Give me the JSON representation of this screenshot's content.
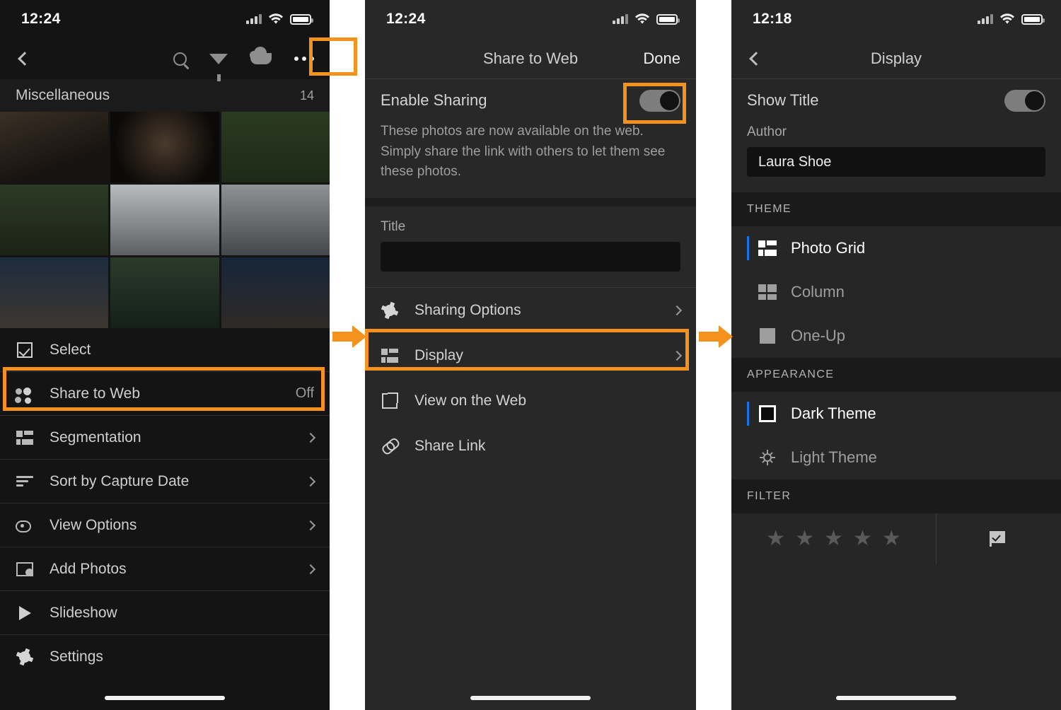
{
  "panels": [
    {
      "id": "album-menu",
      "status": {
        "time": "12:24"
      },
      "nav": {
        "back_icon": "chevron-left-icon",
        "tools": [
          "search-icon",
          "filter-icon",
          "cloud-icon",
          "more-options-icon"
        ]
      },
      "album": {
        "name": "Miscellaneous",
        "count": "14"
      },
      "menu": [
        {
          "label": "Select",
          "icon": "select-checkbox-icon",
          "value": "",
          "chevron": false
        },
        {
          "label": "Share to Web",
          "icon": "people-icon",
          "value": "Off",
          "chevron": false
        },
        {
          "label": "Segmentation",
          "icon": "segmentation-icon",
          "value": "",
          "chevron": true
        },
        {
          "label": "Sort by Capture Date",
          "icon": "sort-icon",
          "value": "",
          "chevron": true
        },
        {
          "label": "View Options",
          "icon": "eye-options-icon",
          "value": "",
          "chevron": true
        },
        {
          "label": "Add Photos",
          "icon": "add-photos-icon",
          "value": "",
          "chevron": true
        },
        {
          "label": "Slideshow",
          "icon": "play-icon",
          "value": "",
          "chevron": false
        },
        {
          "label": "Settings",
          "icon": "gear-icon",
          "value": "",
          "chevron": false
        }
      ]
    },
    {
      "id": "share-to-web",
      "status": {
        "time": "12:24"
      },
      "nav": {
        "title": "Share to Web",
        "done_label": "Done"
      },
      "enable": {
        "label": "Enable Sharing",
        "toggle_state": "on",
        "description": "These photos are now available on the web. Simply share the link with others to let them see these photos."
      },
      "title_field": {
        "label": "Title",
        "value": "",
        "placeholder": ""
      },
      "menu": [
        {
          "label": "Sharing Options",
          "icon": "gear-icon",
          "chevron": true
        },
        {
          "label": "Display",
          "icon": "display-grid-icon",
          "chevron": true
        },
        {
          "label": "View on the Web",
          "icon": "external-link-icon",
          "chevron": false
        },
        {
          "label": "Share Link",
          "icon": "link-icon",
          "chevron": false
        }
      ]
    },
    {
      "id": "display-settings",
      "status": {
        "time": "12:18"
      },
      "nav": {
        "title": "Display",
        "back_icon": "chevron-left-icon"
      },
      "show_title": {
        "label": "Show Title",
        "toggle_state": "on"
      },
      "author_field": {
        "label": "Author",
        "value": "Laura Shoe"
      },
      "sections": [
        {
          "heading": "THEME",
          "options": [
            {
              "label": "Photo Grid",
              "icon": "photo-grid-icon",
              "selected": true
            },
            {
              "label": "Column",
              "icon": "column-icon",
              "selected": false
            },
            {
              "label": "One-Up",
              "icon": "one-up-icon",
              "selected": false
            }
          ]
        },
        {
          "heading": "APPEARANCE",
          "options": [
            {
              "label": "Dark Theme",
              "icon": "dark-square-icon",
              "selected": true
            },
            {
              "label": "Light Theme",
              "icon": "sun-icon",
              "selected": false
            }
          ]
        }
      ],
      "filter": {
        "heading": "FILTER",
        "stars": [
          "star-1",
          "star-2",
          "star-3",
          "star-4",
          "star-5"
        ],
        "flag_icon": "flag-check-icon"
      }
    }
  ],
  "annotations": {
    "accent_color": "#F5921E",
    "highlights": [
      "more-options-button",
      "share-to-web-row",
      "enable-sharing-toggle",
      "display-row"
    ],
    "arrows": [
      "arrow-panel1-to-panel2",
      "arrow-panel2-to-panel3"
    ]
  }
}
